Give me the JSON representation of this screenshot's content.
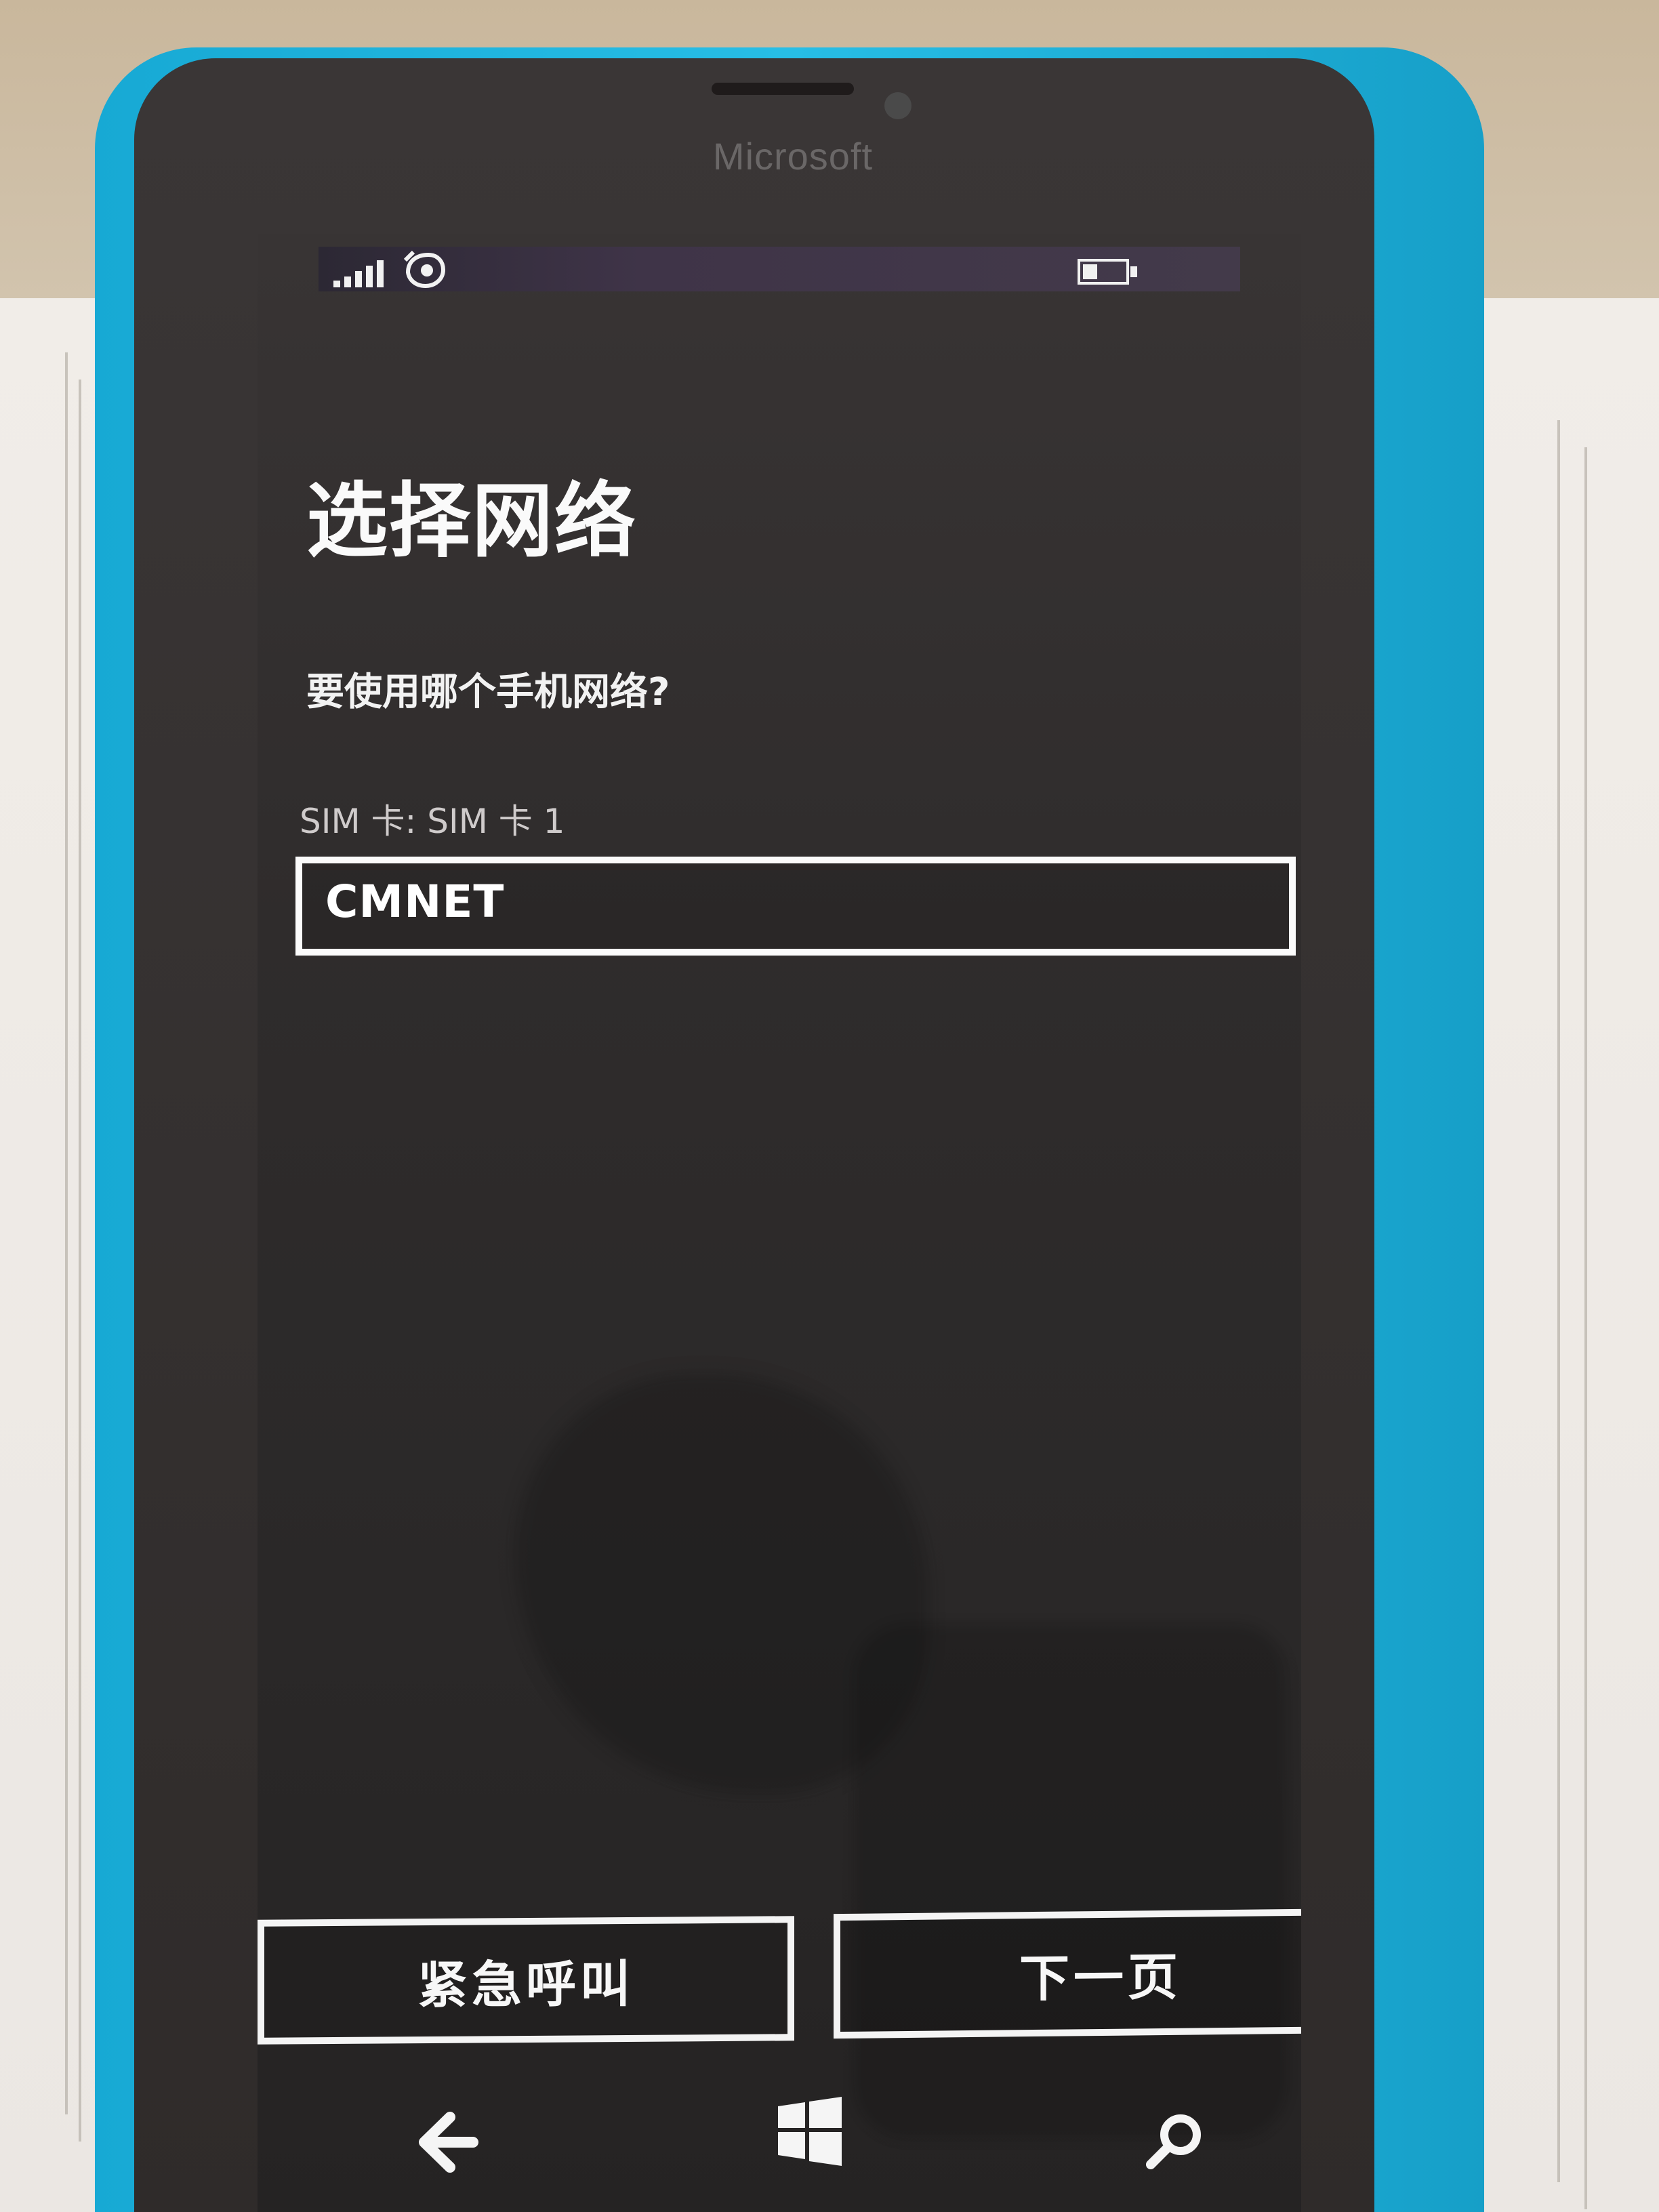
{
  "device": {
    "brand_text": "Microsoft"
  },
  "status_bar": {
    "signal_icon": "signal-strength-icon",
    "data_icon": "mobile-data-icon",
    "battery_icon": "battery-icon",
    "battery_level_fraction": 0.35
  },
  "screen": {
    "title": "选择网络",
    "question": "要使用哪个手机网络?",
    "sim_label": "SIM 卡: SIM 卡 1",
    "network_selector": {
      "value": "CMNET"
    }
  },
  "buttons": {
    "emergency_label": "紧急呼叫",
    "next_label": "下一页"
  },
  "nav_bar": {
    "back_icon": "back-arrow-icon",
    "start_icon": "windows-start-icon",
    "search_icon": "search-icon"
  },
  "colors": {
    "phone_body": "#27bee6",
    "screen_bg": "#2f2c2c",
    "foreground": "#ffffff"
  }
}
